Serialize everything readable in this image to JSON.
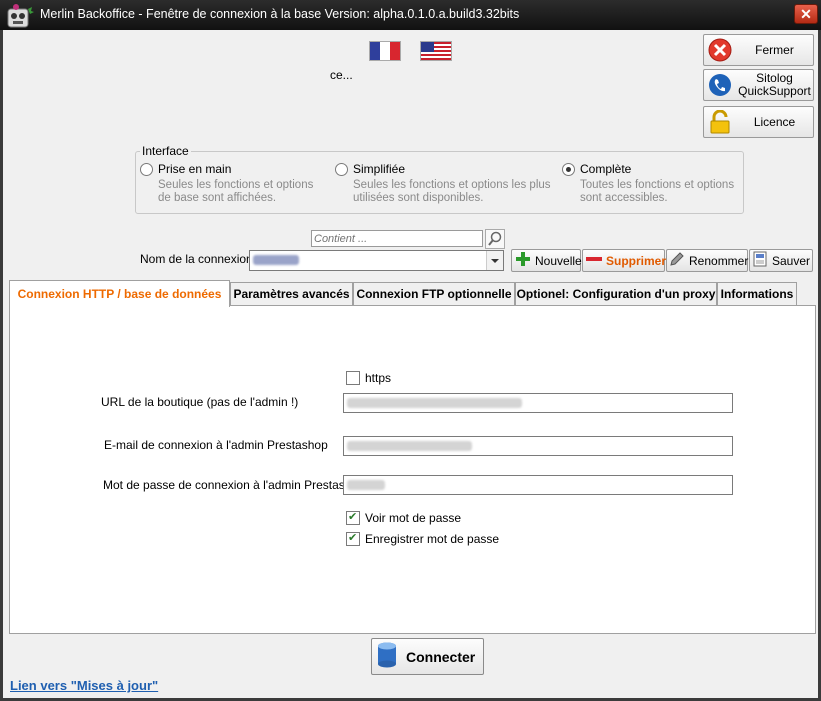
{
  "window": {
    "title": "Merlin Backoffice - Fenêtre de connexion à la base  Version: alpha.0.1.0.a.build3.32bits",
    "close_symbol": "✕"
  },
  "status_fragment": "ce...",
  "languages": [
    {
      "name": "french-flag-icon"
    },
    {
      "name": "us-flag-icon"
    }
  ],
  "side_buttons": {
    "fermer": "Fermer",
    "quicksupport": "Sitolog QuickSupport",
    "licence": "Licence"
  },
  "interface": {
    "legend": "Interface",
    "options": [
      {
        "label": "Prise en main",
        "desc": "Seules les fonctions et options de base sont affichées.",
        "selected": false
      },
      {
        "label": "Simplifiée",
        "desc": "Seules les fonctions et options les plus utilisées sont disponibles.",
        "selected": false
      },
      {
        "label": "Complète",
        "desc": "Toutes les fonctions et options sont accessibles.",
        "selected": true
      }
    ]
  },
  "connection": {
    "search_placeholder": "Contient ...",
    "label": "Nom de la connexion",
    "buttons": {
      "nouvelle": "Nouvelle",
      "supprimer": "Supprimer",
      "renommer": "Renommer",
      "sauver": "Sauver"
    }
  },
  "tabs": [
    "Connexion HTTP / base de données",
    "Paramètres avancés",
    "Connexion FTP optionnelle",
    "Optionel: Configuration d'un proxy",
    "Informations"
  ],
  "form": {
    "https_label": "https",
    "url_label": "URL de la boutique (pas de l'admin !)",
    "email_label": "E-mail de connexion à l'admin Prestashop",
    "password_label": "Mot de passe de connexion à l'admin Prestashop",
    "show_password_label": "Voir mot de passe",
    "save_password_label": "Enregistrer mot de passe",
    "https_checked": false,
    "show_password_checked": true,
    "save_password_checked": true
  },
  "connect_button": "Connecter",
  "updates_link": "Lien vers \"Mises à jour\"",
  "colors": {
    "active_tab": "#ee6a00",
    "delete": "#e05a00",
    "link": "#1f5fb0"
  }
}
